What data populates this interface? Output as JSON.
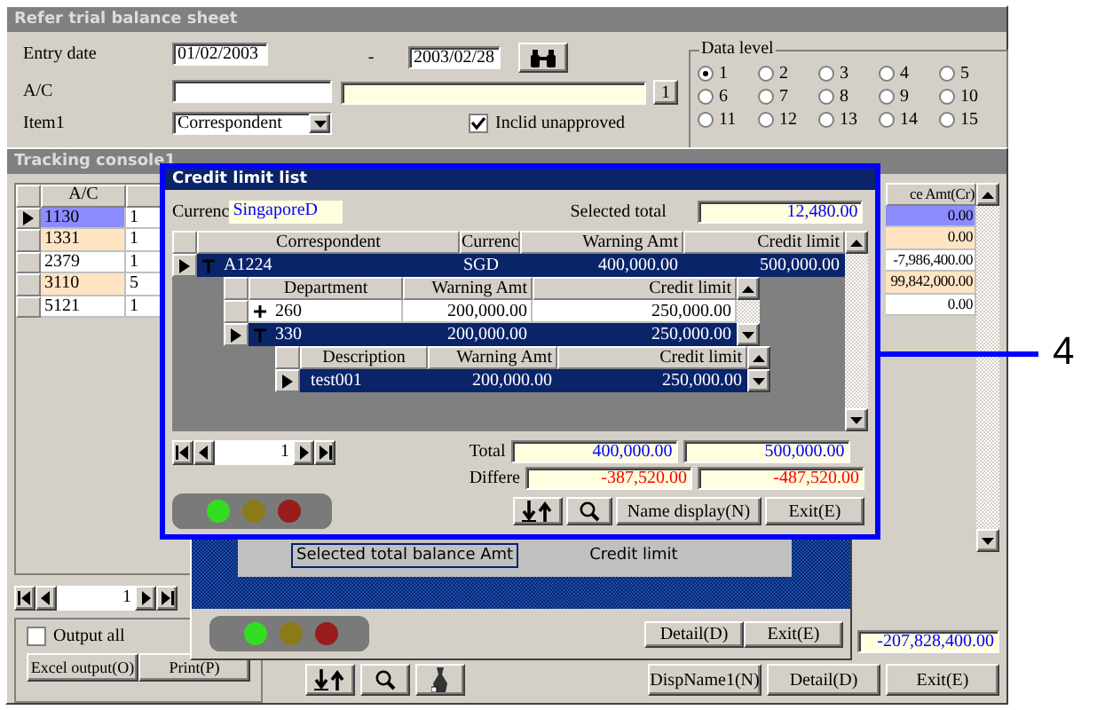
{
  "back_window": {
    "title": "Refer trial balance sheet",
    "entry_date": {
      "label": "Entry date",
      "from": "01/02/2003",
      "separator": "-",
      "to": "2003/02/28"
    },
    "ac": {
      "label": "A/C"
    },
    "range_button": "1",
    "item": {
      "label": "Item1",
      "value": "Correspondent"
    },
    "include_unapproved": {
      "label": "Inclid unapproved",
      "checked": true
    },
    "data_level": {
      "title": "Data level",
      "options": [
        {
          "label": "1",
          "selected": true
        },
        {
          "label": "2",
          "selected": false
        },
        {
          "label": "3",
          "selected": false
        },
        {
          "label": "4",
          "selected": false
        },
        {
          "label": "5",
          "selected": false
        },
        {
          "label": "6",
          "selected": false
        },
        {
          "label": "7",
          "selected": false
        },
        {
          "label": "8",
          "selected": false
        },
        {
          "label": "9",
          "selected": false
        },
        {
          "label": "10",
          "selected": false
        },
        {
          "label": "11",
          "selected": false
        },
        {
          "label": "12",
          "selected": false
        },
        {
          "label": "13",
          "selected": false
        },
        {
          "label": "14",
          "selected": false
        },
        {
          "label": "15",
          "selected": false
        }
      ]
    }
  },
  "tracking_window": {
    "title": "Tracking console1",
    "columns": [
      "A/C",
      "ce Amt(Cr)"
    ],
    "rows": [
      {
        "ac": "1130",
        "column_2": "1",
        "amount": "0.00",
        "selected": true,
        "color": "#8c8cff"
      },
      {
        "ac": "1331",
        "column_2": "1",
        "amount": "0.00",
        "selected": false,
        "color": "#ffe4c4"
      },
      {
        "ac": "2379",
        "column_2": "1",
        "amount": "-7,986,400.00",
        "selected": false,
        "color": "#ffffff"
      },
      {
        "ac": "3110",
        "column_2": "5",
        "amount": "99,842,000.00",
        "selected": false,
        "color": "#ffe4c4"
      },
      {
        "ac": "5121",
        "column_2": "1",
        "amount": "0.00",
        "selected": false,
        "color": "#ffffff"
      }
    ],
    "page": "1",
    "output_all": {
      "label": "Output all",
      "checked": false
    },
    "left_buttons": [
      "Excel output(O)",
      "Print(P)"
    ],
    "total": "-207,828,400.00",
    "buttons": [
      "DispName1(N)",
      "Detail(D)",
      "Exit(E)"
    ]
  },
  "detail_window": {
    "texts": [
      "Selected total balance Amt",
      "Credit limit"
    ],
    "buttons": [
      "Detail(D)",
      "Exit(E)"
    ]
  },
  "credit_window": {
    "title": "Credit limit list",
    "currency_label": "Currenc",
    "currency": "SingaporeD",
    "selected_total_label": "Selected total",
    "selected_total": "12,480.00",
    "grids": [
      {
        "columns": [
          "Correspondent",
          "Currenc",
          "Warning Amt",
          "Credit limit"
        ],
        "rows": [
          {
            "cells": [
              "A1224",
              "SGD",
              "400,000.00",
              "500,000.00"
            ],
            "selected": true,
            "expanded": true
          }
        ]
      },
      {
        "columns": [
          "Department",
          "Warning Amt",
          "Credit limit"
        ],
        "rows": [
          {
            "cells": [
              "260",
              "200,000.00",
              "250,000.00"
            ],
            "selected": false,
            "expanded": false
          },
          {
            "cells": [
              "330",
              "200,000.00",
              "250,000.00"
            ],
            "selected": true,
            "expanded": true
          }
        ]
      },
      {
        "columns": [
          "Description",
          "Warning Amt",
          "Credit limit"
        ],
        "rows": [
          {
            "cells": [
              "test001",
              "200,000.00",
              "250,000.00"
            ],
            "selected": true
          }
        ]
      }
    ],
    "page": "1",
    "total_label": "Total",
    "totals": [
      "400,000.00",
      "500,000.00"
    ],
    "difference_label": "Differe",
    "differences": [
      "-387,520.00",
      "-487,520.00"
    ],
    "buttons": [
      "Name display(N)",
      "Exit(E)"
    ]
  },
  "callout": "4"
}
